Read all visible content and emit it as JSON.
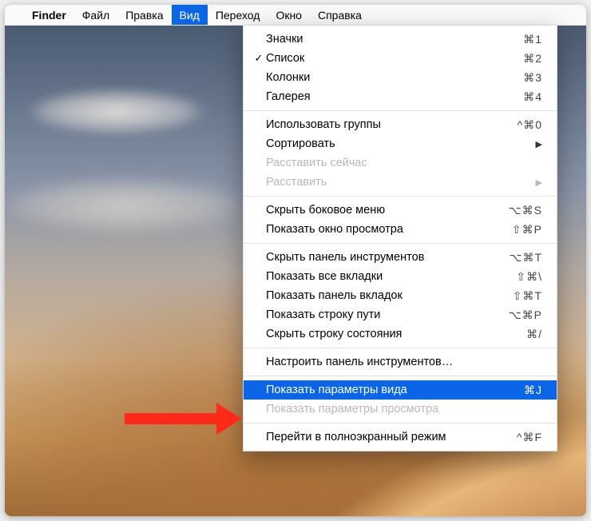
{
  "menubar": {
    "apple": "",
    "app": "Finder",
    "items": [
      "Файл",
      "Правка",
      "Вид",
      "Переход",
      "Окно",
      "Справка"
    ],
    "activeIndex": 2
  },
  "menu": {
    "groups": [
      [
        {
          "label": "Значки",
          "shortcut": "⌘1",
          "checked": false
        },
        {
          "label": "Список",
          "shortcut": "⌘2",
          "checked": true
        },
        {
          "label": "Колонки",
          "shortcut": "⌘3",
          "checked": false
        },
        {
          "label": "Галерея",
          "shortcut": "⌘4",
          "checked": false
        }
      ],
      [
        {
          "label": "Использовать группы",
          "shortcut": "^⌘0"
        },
        {
          "label": "Сортировать",
          "submenu": true
        },
        {
          "label": "Расставить сейчас",
          "disabled": true
        },
        {
          "label": "Расставить",
          "submenu": true,
          "disabled": true
        }
      ],
      [
        {
          "label": "Скрыть боковое меню",
          "shortcut": "⌥⌘S"
        },
        {
          "label": "Показать окно просмотра",
          "shortcut": "⇧⌘P"
        }
      ],
      [
        {
          "label": "Скрыть панель инструментов",
          "shortcut": "⌥⌘T"
        },
        {
          "label": "Показать все вкладки",
          "shortcut": "⇧⌘\\"
        },
        {
          "label": "Показать панель вкладок",
          "shortcut": "⇧⌘T"
        },
        {
          "label": "Показать строку пути",
          "shortcut": "⌥⌘P"
        },
        {
          "label": "Скрыть строку состояния",
          "shortcut": "⌘/"
        }
      ],
      [
        {
          "label": "Настроить панель инструментов…"
        }
      ],
      [
        {
          "label": "Показать параметры вида",
          "shortcut": "⌘J",
          "highlighted": true
        },
        {
          "label": "Показать параметры просмотра",
          "disabled": true
        }
      ],
      [
        {
          "label": "Перейти в полноэкранный режим",
          "shortcut": "^⌘F"
        }
      ]
    ]
  }
}
